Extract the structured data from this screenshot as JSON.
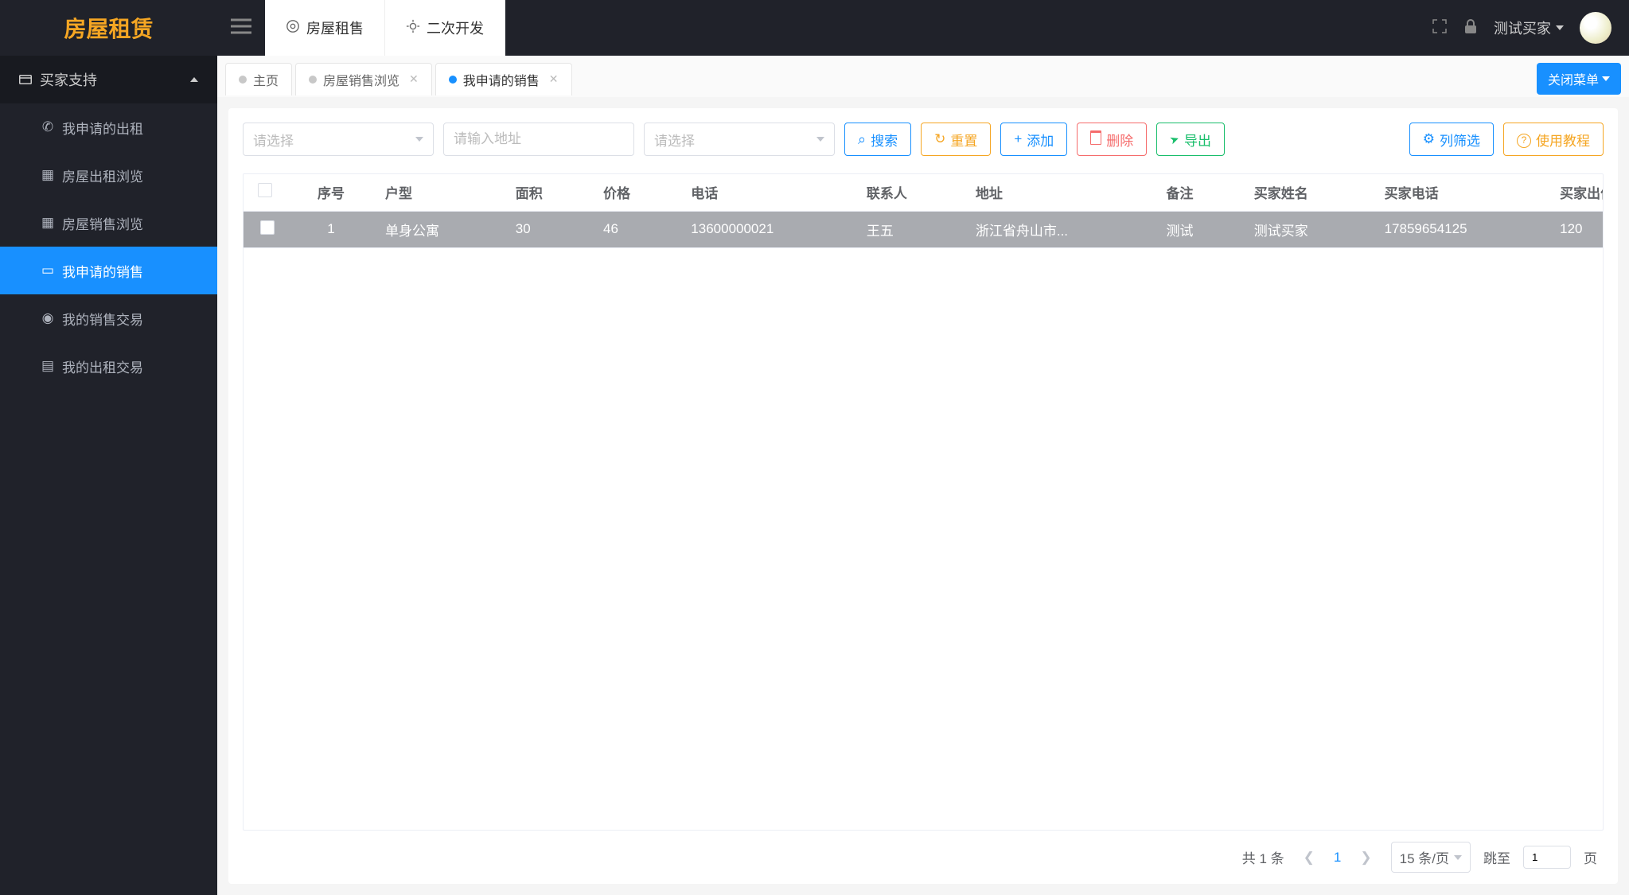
{
  "header": {
    "logo": "房屋租赁",
    "top_tabs": [
      {
        "label": "房屋租售"
      },
      {
        "label": "二次开发"
      }
    ],
    "user": "测试买家"
  },
  "sidebar": {
    "group": "买家支持",
    "items": [
      {
        "label": "我申请的出租",
        "icon": "phone"
      },
      {
        "label": "房屋出租浏览",
        "icon": "grid"
      },
      {
        "label": "房屋销售浏览",
        "icon": "grid"
      },
      {
        "label": "我申请的销售",
        "icon": "card",
        "active": true
      },
      {
        "label": "我的销售交易",
        "icon": "coin"
      },
      {
        "label": "我的出租交易",
        "icon": "list"
      }
    ]
  },
  "tabs": {
    "items": [
      {
        "label": "主页",
        "closable": false
      },
      {
        "label": "房屋销售浏览",
        "closable": true
      },
      {
        "label": "我申请的销售",
        "closable": true,
        "active": true
      }
    ],
    "close_menu": "关闭菜单"
  },
  "toolbar": {
    "select1_placeholder": "请选择",
    "address_placeholder": "请输入地址",
    "select2_placeholder": "请选择",
    "search": "搜索",
    "reset": "重置",
    "add": "添加",
    "delete": "删除",
    "export": "导出",
    "columns": "列筛选",
    "tutorial": "使用教程"
  },
  "table": {
    "headers": [
      "序号",
      "户型",
      "面积",
      "价格",
      "电话",
      "联系人",
      "地址",
      "备注",
      "买家姓名",
      "买家电话",
      "买家出价"
    ],
    "rows": [
      {
        "idx": "1",
        "type": "单身公寓",
        "area": "30",
        "price": "46",
        "phone": "13600000021",
        "contact": "王五",
        "addr": "浙江省舟山市...",
        "remark": "测试",
        "buyer": "测试买家",
        "buyer_phone": "17859654125",
        "offer": "120"
      }
    ]
  },
  "pager": {
    "total": "共 1 条",
    "current": "1",
    "size": "15 条/页",
    "jump_label": "跳至",
    "jump_value": "1",
    "page_suffix": "页"
  }
}
